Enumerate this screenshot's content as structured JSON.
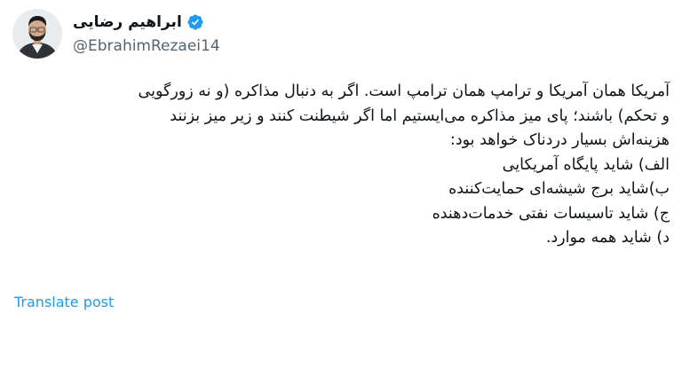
{
  "author": {
    "display_name": "ابراهیم رضایی",
    "handle": "@EbrahimRezaei14",
    "verified": true,
    "avatar_icon": "profile-photo",
    "verified_icon": "verified-badge-icon"
  },
  "post": {
    "lines": [
      "آمریکا همان آمریکا و ترامپ همان ترامپ است. اگر به دنبال مذاکره (و نه زورگویی",
      "و تحکم) باشند؛ پای میز مذاکره می‌ایستیم اما اگر شیطنت کنند و زیر میز بزنند",
      "هزینه‌اش بسیار دردناک خواهد بود:",
      "الف) شاید پایگاه آمریکایی",
      "ب)شاید برج شیشه‌ای حمایت‌کننده",
      "ج) شاید تاسیسات نفتی خدمات‌دهنده",
      "د) شاید همه موارد."
    ]
  },
  "actions": {
    "translate_label": "Translate post"
  },
  "colors": {
    "text": "#0f1419",
    "secondary": "#536471",
    "link": "#1d9bf0",
    "verified": "#1d9bf0"
  }
}
